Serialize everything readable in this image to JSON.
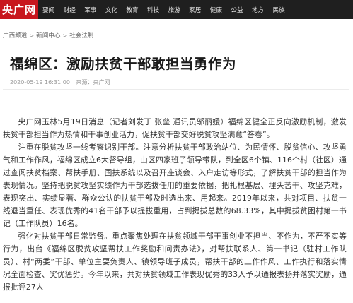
{
  "site": {
    "logo_text": "央广网"
  },
  "nav": {
    "items": [
      "要闻",
      "财经",
      "军事",
      "文化",
      "教育",
      "科技",
      "旅游",
      "家居",
      "健康",
      "公益",
      "地方",
      "民族"
    ]
  },
  "breadcrumb": {
    "items": [
      "广西频道",
      "新闻中心",
      "社会法制"
    ]
  },
  "article": {
    "title": "福绵区：激励扶贫干部敢担当勇作为",
    "timestamp": "2020-05-19 16:31:00",
    "source": "来源：央广网",
    "paragraphs": [
      "央广网玉林5月19日消息（记者刘发丁 张垒 通讯员邬丽媛）福绵区健全正反向激励机制，激发扶贫干部担当作为热情和干事创业活力，促扶贫干部交好脱贫攻坚满意“答卷”。",
      "注重在脱贫攻坚一线考察识别干部。注意分析扶贫干部政治站位、为民情怀、脱贫信心、攻坚勇气和工作作风，福绵区成立6大督导组，由区四家班子领导带队，到全区6个镇、116个村（社区）通过查阅扶贫档案、帮扶手册、国扶系统以及召开座谈会、入户走访等形式，了解扶贫干部的担当作为表现情况。坚持把脱贫攻坚实绩作为干部选拔任用的重要依据，把扎根基层、埋头苦干、攻坚克难，表现突出、实绩显著、群众公认的扶贫干部及时选出来、用起来。2019年以来，共对项目、扶贫一线退当重任、表现优秀的41名干部予以提拔重用，占到提拔总数的68.33%，其中提拔贫困村第一书记（工作队员）16名。",
      "强化对扶贫干部日常监督。重点聚焦处理在扶贫领域干部干事创业不担当、不作为，不严不实等行为，出台《福绵区脱贫攻坚帮扶工作奖励和问责办法》，对帮扶联系人、第一书记（驻村工作队员）、村“两委”干部、单位主要负责人、镇领导班子成员，帮扶干部的工作作风、工作执行和落实情况全面检查、奖优惩劣。今年以来，共对扶贫领域工作表现优秀的33人予以通报表扬并落实奖励，通报批评27人"
    ]
  }
}
